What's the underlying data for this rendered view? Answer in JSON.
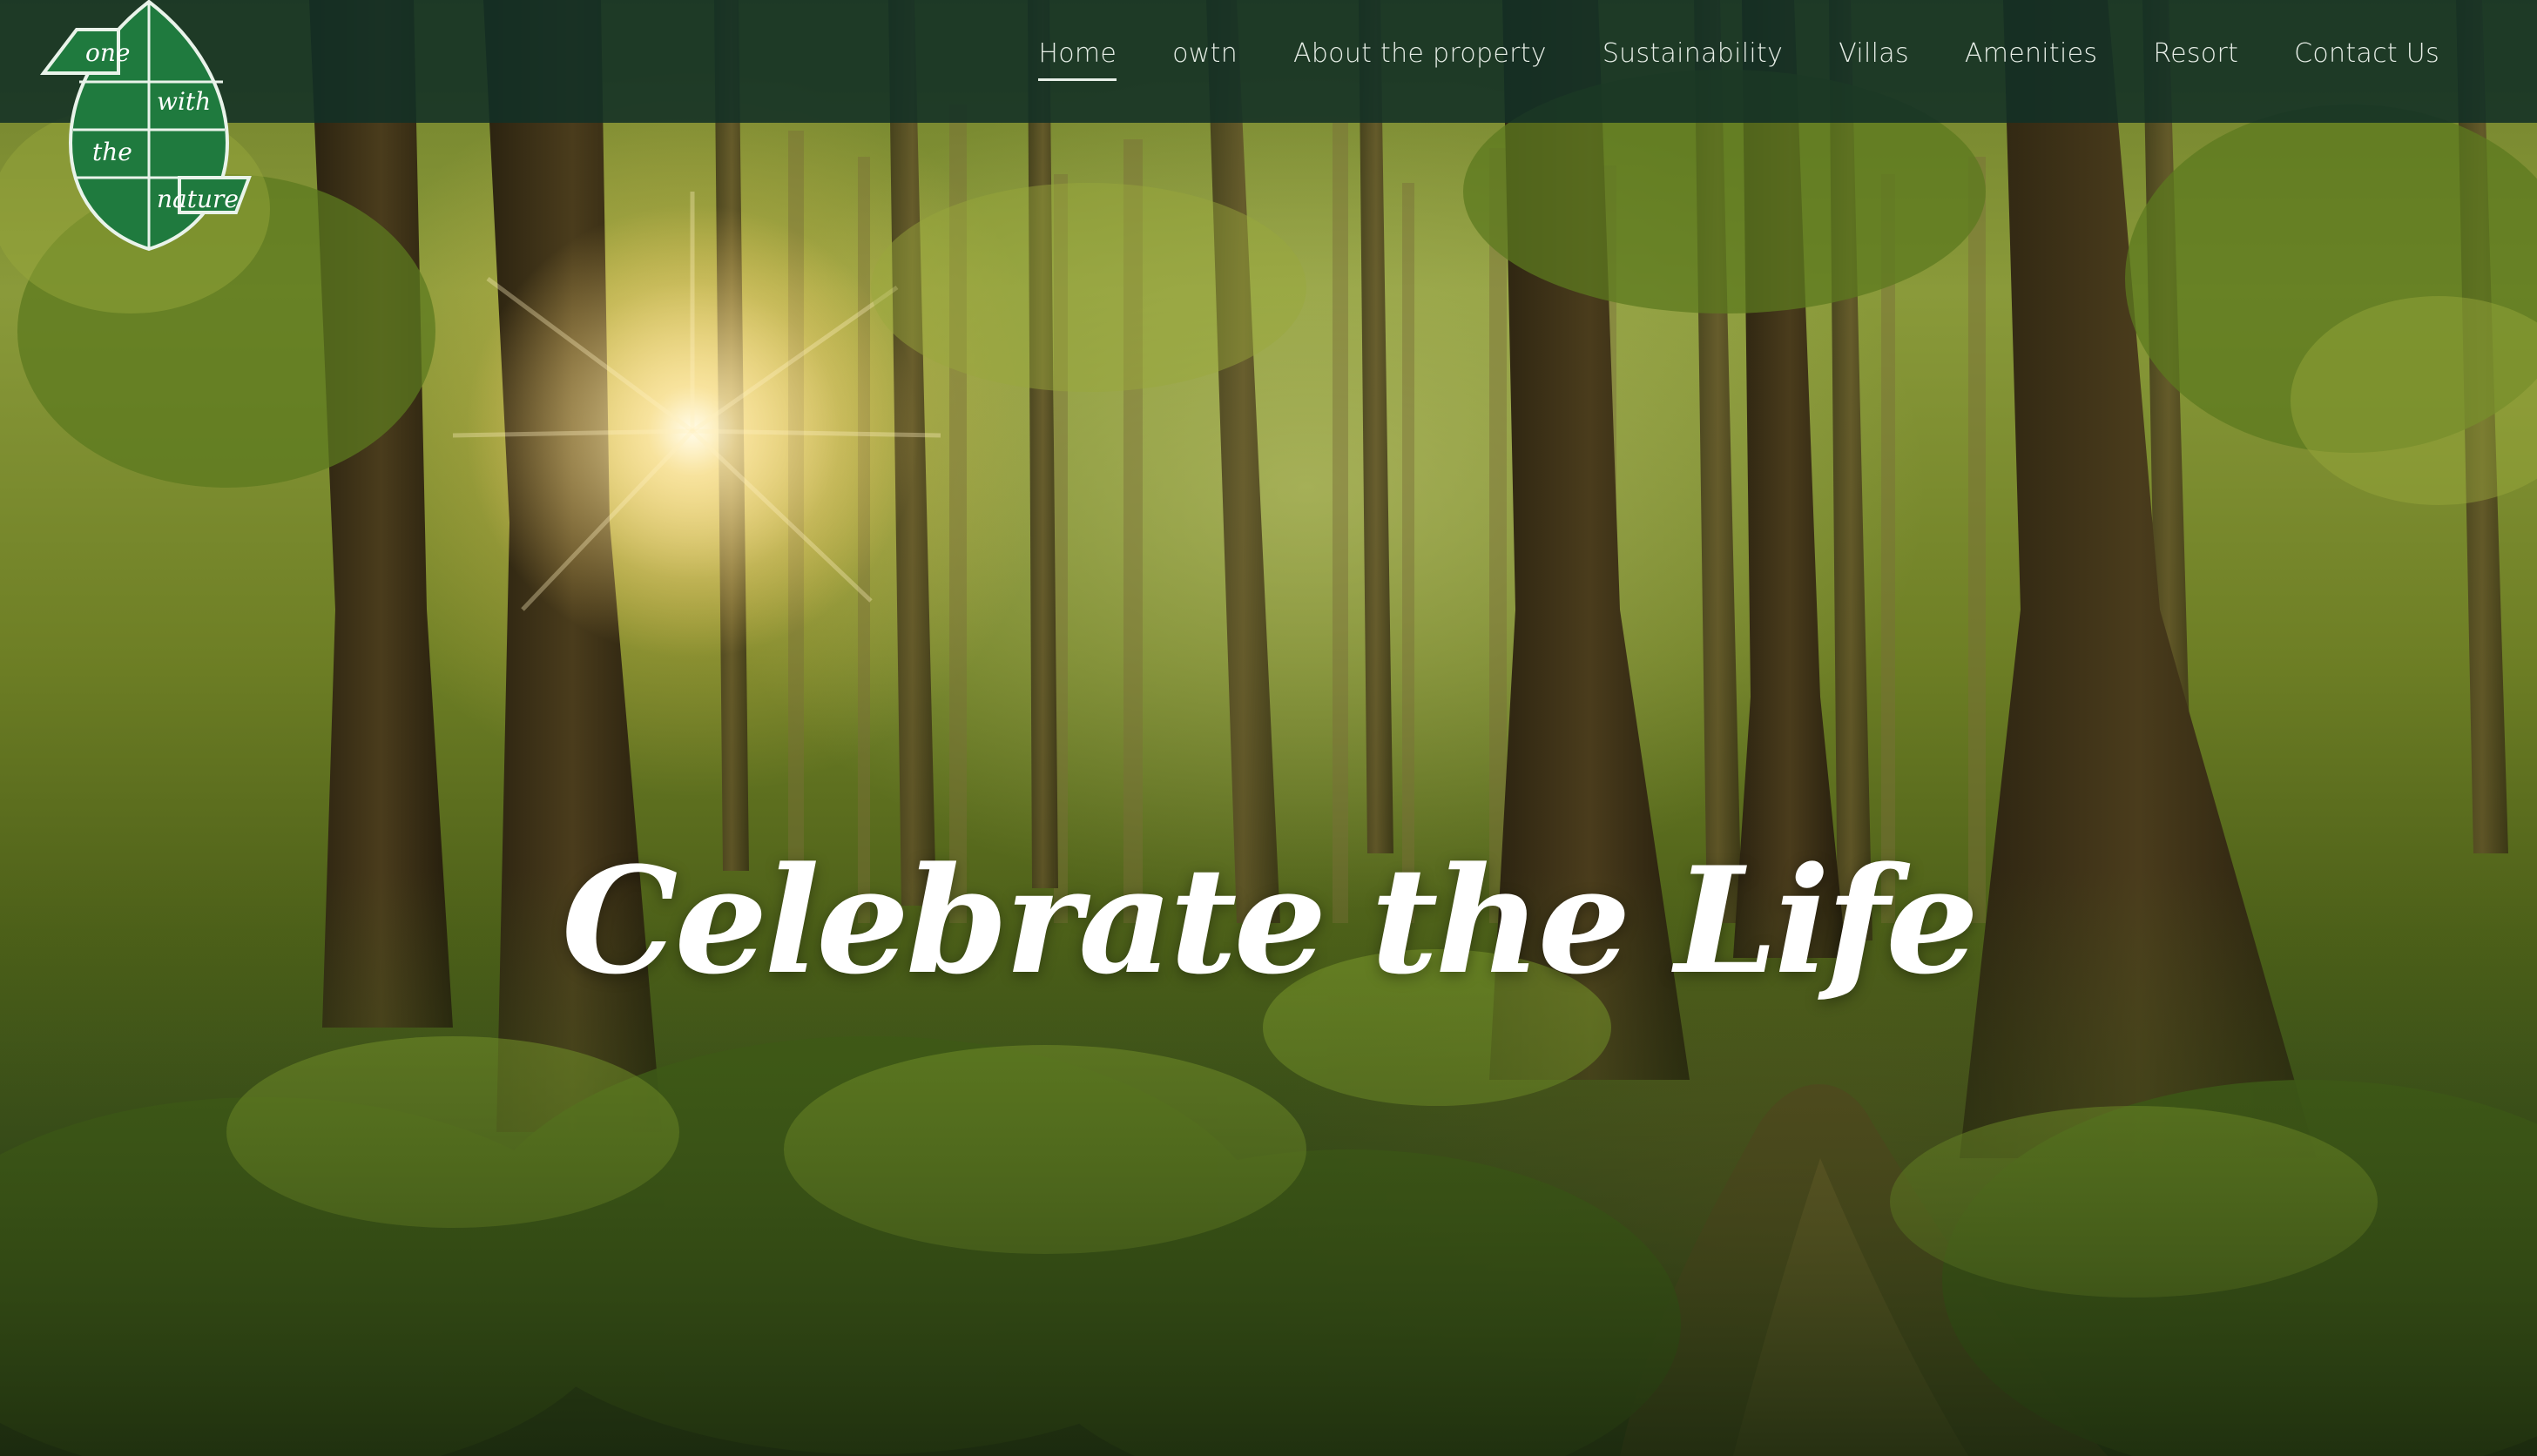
{
  "logo": {
    "words": [
      "one",
      "with",
      "the",
      "nature"
    ]
  },
  "nav": {
    "items": [
      {
        "label": "Home",
        "active": true
      },
      {
        "label": "owtn",
        "active": false
      },
      {
        "label": "About the property",
        "active": false
      },
      {
        "label": "Sustainability",
        "active": false
      },
      {
        "label": "Villas",
        "active": false
      },
      {
        "label": "Amenities",
        "active": false
      },
      {
        "label": "Resort",
        "active": false
      },
      {
        "label": "Contact Us",
        "active": false
      }
    ]
  },
  "hero": {
    "headline": "Celebrate the Life"
  },
  "colors": {
    "navbar": "#123026",
    "logo_green": "#1f7a3e",
    "nav_text": "#e6ede6",
    "headline": "#ffffff"
  }
}
